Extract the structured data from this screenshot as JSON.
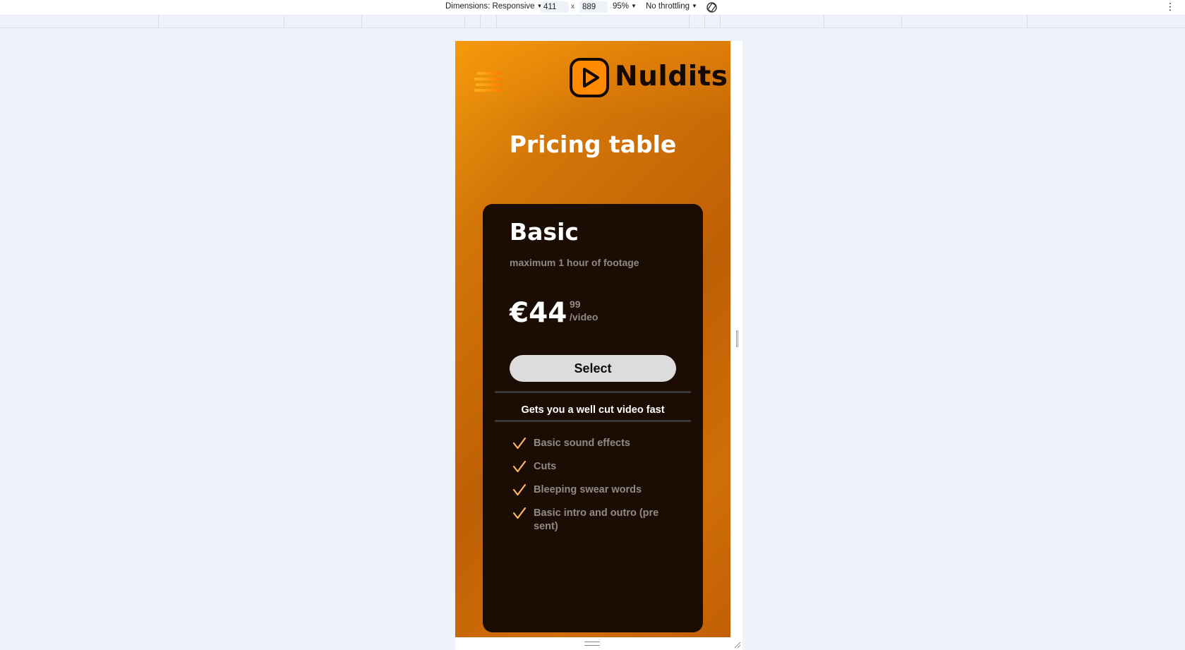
{
  "devtools": {
    "dimensions_label": "Dimensions: Responsive",
    "width": "411",
    "times": "x",
    "height": "889",
    "zoom": "95%",
    "throttling": "No throttling"
  },
  "site": {
    "brand": "Nuldits",
    "brand_color": "#ff8a00",
    "page_title": "Pricing table"
  },
  "plan": {
    "name": "Basic",
    "subtitle": "maximum 1 hour of footage",
    "price_main": "€44",
    "price_cents": "99",
    "price_unit": "/video",
    "select_label": "Select",
    "tagline": "Gets you a well cut video fast",
    "features": [
      "Basic sound effects",
      "Cuts",
      "Bleeping swear words",
      "Basic intro and outro (pre sent)"
    ],
    "check_color": "#ffb56b"
  },
  "icons": {
    "menu": "hamburger-menu-icon",
    "logo": "play-icon",
    "check": "check-icon",
    "rotate": "rotate-icon",
    "more": "more-vert-icon"
  }
}
